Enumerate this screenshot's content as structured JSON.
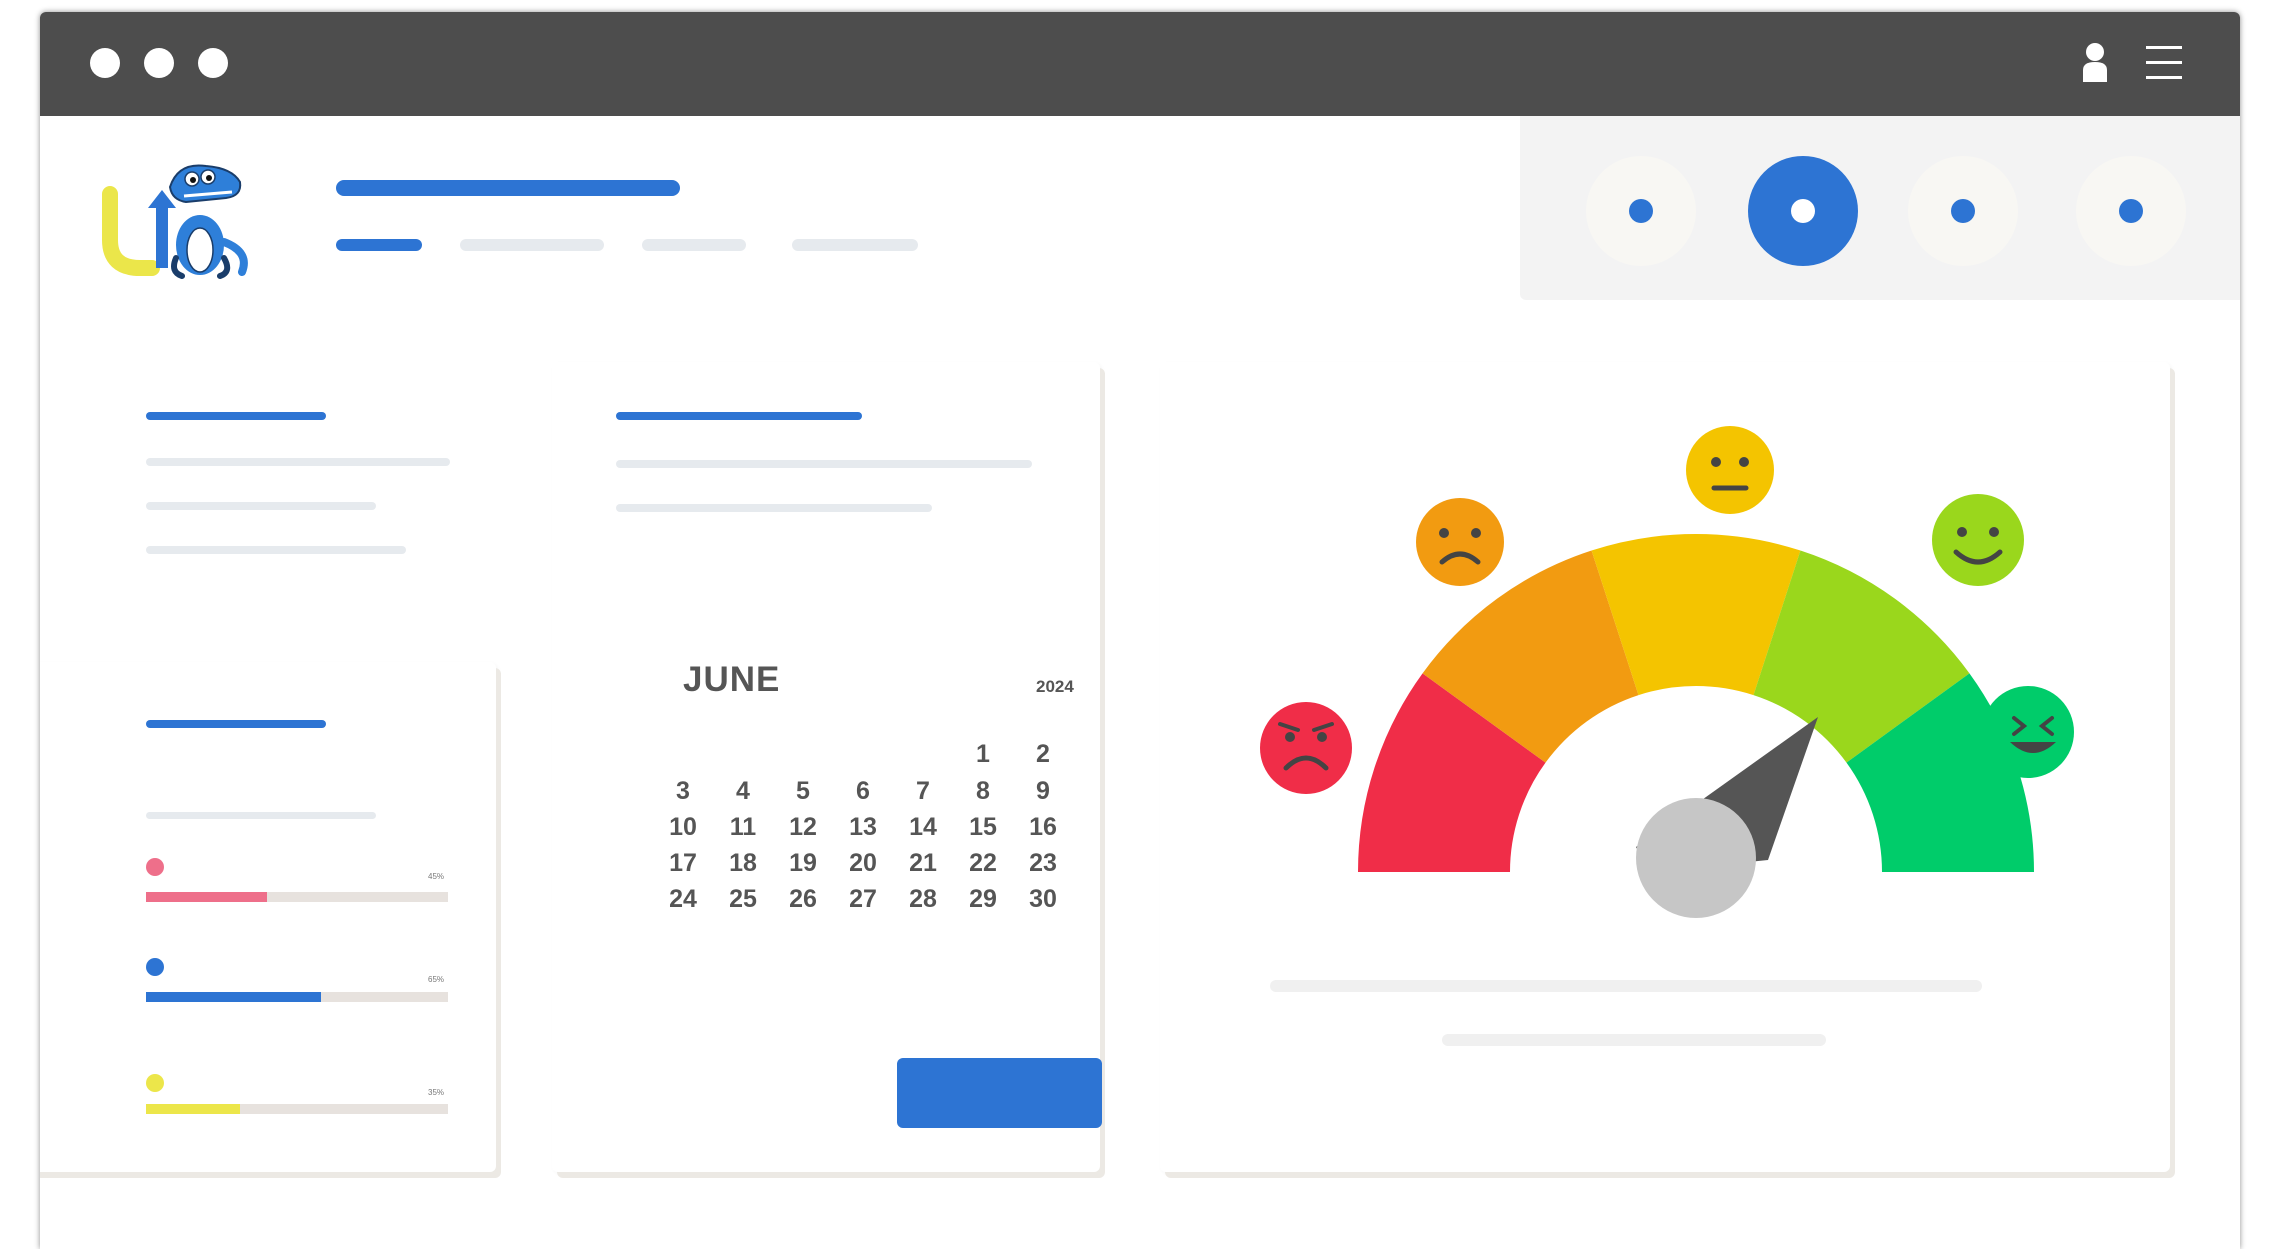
{
  "window": {
    "title_dots": [
      "close",
      "minimize",
      "maximize"
    ],
    "toolbar_icons": [
      "user-icon",
      "menu-icon"
    ]
  },
  "steps": [
    {
      "name": "step-1",
      "active": false
    },
    {
      "name": "step-2",
      "active": true
    },
    {
      "name": "step-3",
      "active": false
    },
    {
      "name": "step-4",
      "active": false
    }
  ],
  "calendar": {
    "month": "JUNE",
    "year": "2024",
    "days": [
      [
        "",
        "",
        "",
        "",
        "",
        "1",
        "2"
      ],
      [
        "3",
        "4",
        "5",
        "6",
        "7",
        "8",
        "9"
      ],
      [
        "10",
        "11",
        "12",
        "13",
        "14",
        "15",
        "16"
      ],
      [
        "17",
        "18",
        "19",
        "20",
        "21",
        "22",
        "23"
      ],
      [
        "24",
        "25",
        "26",
        "27",
        "28",
        "29",
        "30"
      ]
    ]
  },
  "progress": [
    {
      "label": "45%",
      "value": 0.4,
      "color": "#ee6f8a"
    },
    {
      "label": "65%",
      "value": 0.58,
      "color": "#2d74d3"
    },
    {
      "label": "35%",
      "value": 0.31,
      "color": "#ece64a"
    }
  ],
  "gauge": {
    "levels": [
      {
        "name": "very-unhappy",
        "color": "#f02d48"
      },
      {
        "name": "unhappy",
        "color": "#f29b11"
      },
      {
        "name": "neutral",
        "color": "#f4c400"
      },
      {
        "name": "happy",
        "color": "#9ad71c"
      },
      {
        "name": "very-happy",
        "color": "#00cc6a"
      }
    ],
    "needle_level": "happy"
  },
  "colors": {
    "accent": "#2d74d3",
    "titlebar": "#4d4d4d",
    "placeholder": "#e6eaee"
  }
}
